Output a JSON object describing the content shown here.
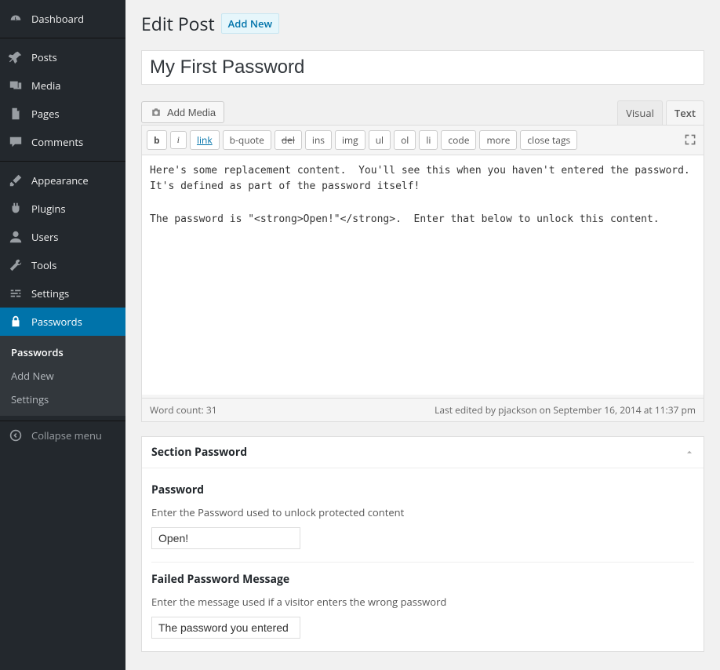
{
  "sidebar": {
    "menu": [
      {
        "label": "Dashboard",
        "icon": "dashboard"
      },
      {
        "label": "Posts",
        "icon": "pin"
      },
      {
        "label": "Media",
        "icon": "media"
      },
      {
        "label": "Pages",
        "icon": "page"
      },
      {
        "label": "Comments",
        "icon": "comment"
      },
      {
        "label": "Appearance",
        "icon": "brush"
      },
      {
        "label": "Plugins",
        "icon": "plug"
      },
      {
        "label": "Users",
        "icon": "user"
      },
      {
        "label": "Tools",
        "icon": "wrench"
      },
      {
        "label": "Settings",
        "icon": "sliders"
      },
      {
        "label": "Passwords",
        "icon": "lock",
        "current": true
      }
    ],
    "submenu": [
      {
        "label": "Passwords",
        "active": true
      },
      {
        "label": "Add New"
      },
      {
        "label": "Settings"
      }
    ],
    "collapse": "Collapse menu"
  },
  "header": {
    "title": "Edit Post",
    "add_new": "Add New"
  },
  "post": {
    "title": "My First Password"
  },
  "media": {
    "add_media": "Add Media"
  },
  "editor": {
    "tabs": {
      "visual": "Visual",
      "text": "Text"
    },
    "quicktags": [
      "b",
      "i",
      "link",
      "b-quote",
      "del",
      "ins",
      "img",
      "ul",
      "ol",
      "li",
      "code",
      "more",
      "close tags"
    ],
    "content": "Here's some replacement content.  You'll see this when you haven't entered the password.  It's defined as part of the password itself!\n\nThe password is \"<strong>Open!\"</strong>.  Enter that below to unlock this content.",
    "word_count_label": "Word count: ",
    "word_count": "31",
    "last_edited": "Last edited by pjackson on September 16, 2014 at 11:37 pm"
  },
  "section_password": {
    "title": "Section Password",
    "password": {
      "label": "Password",
      "desc": "Enter the Password used to unlock protected content",
      "value": "Open!"
    },
    "failed": {
      "label": "Failed Password Message",
      "desc": "Enter the message used if a visitor enters the wrong password",
      "value": "The password you entered"
    }
  }
}
